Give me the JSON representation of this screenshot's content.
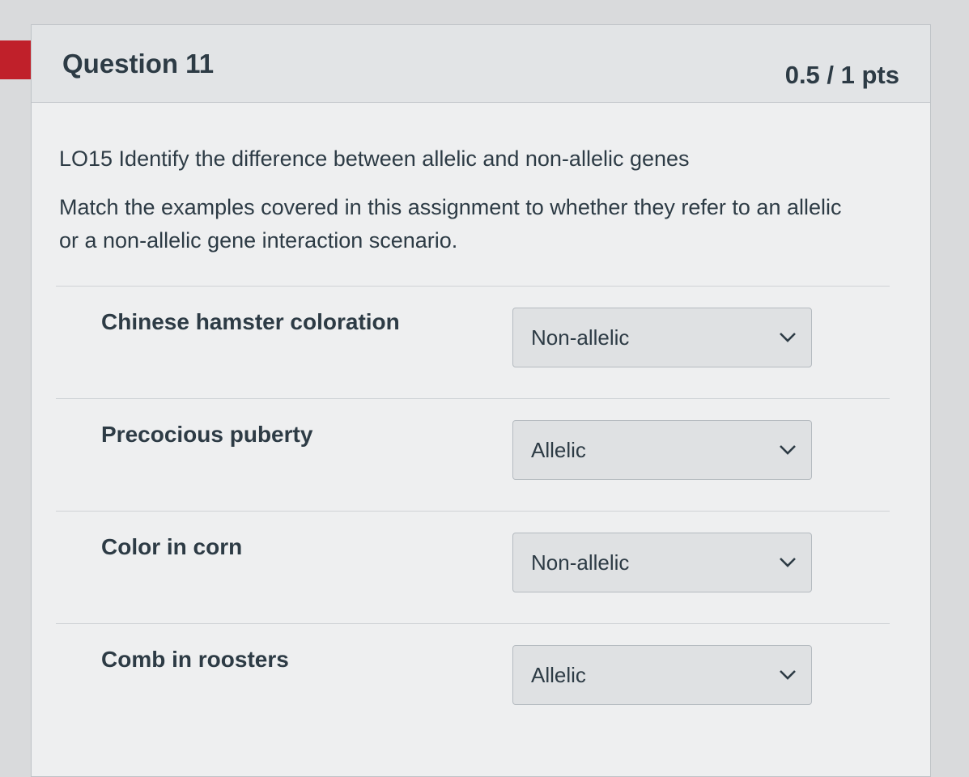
{
  "question": {
    "title": "Question 11",
    "points": "0.5 / 1 pts",
    "objective": "LO15 Identify the difference between allelic and non-allelic genes",
    "instructions": "Match the examples covered in this assignment to whether they refer to an allelic or a non-allelic gene interaction scenario."
  },
  "matches": [
    {
      "label": "Chinese hamster coloration",
      "selected": "Non-allelic"
    },
    {
      "label": "Precocious puberty",
      "selected": "Allelic"
    },
    {
      "label": "Color in corn",
      "selected": "Non-allelic"
    },
    {
      "label": "Comb in roosters",
      "selected": "Allelic"
    }
  ],
  "colors": {
    "marker": "#c0202a",
    "text": "#2d3b45",
    "select_bg": "#dfe1e3"
  },
  "icons": {
    "dropdown": "chevron-down-icon",
    "question_marker": "flag-marker-icon"
  }
}
